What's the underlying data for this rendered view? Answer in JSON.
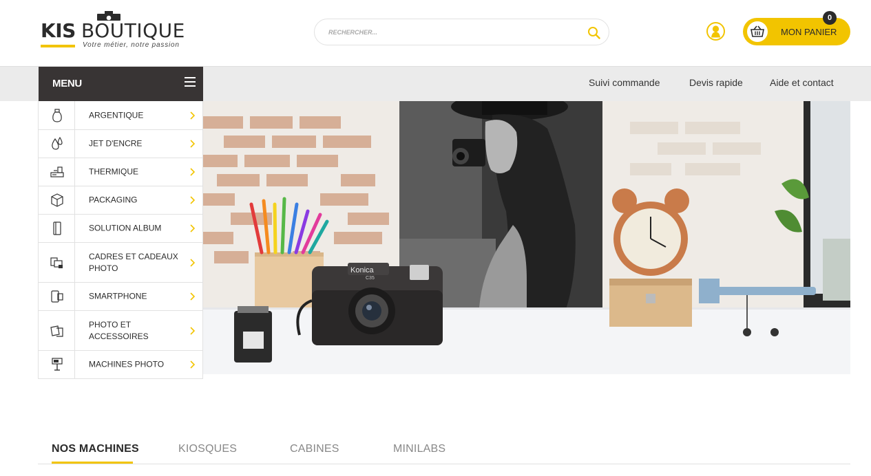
{
  "header": {
    "logo": {
      "brand_bold": "KIS",
      "brand_light": "BOUTIQUE",
      "tagline": "Votre métier, notre passion"
    },
    "search": {
      "placeholder": "RECHERCHER..."
    },
    "cart": {
      "label": "MON PANIER",
      "count": "0"
    },
    "icons": {
      "search": "search-icon",
      "account": "user-account-icon",
      "cart": "basket-icon"
    },
    "colors": {
      "accent": "#f2c400",
      "dark": "#383434"
    }
  },
  "nav": {
    "menu_label": "MENU",
    "links": [
      {
        "label": "Suivi commande"
      },
      {
        "label": "Devis rapide"
      },
      {
        "label": "Aide et contact"
      }
    ]
  },
  "sidebar": {
    "items": [
      {
        "label": "ARGENTIQUE",
        "icon": "film-bottle-icon"
      },
      {
        "label": "JET D'ENCRE",
        "icon": "ink-drops-icon"
      },
      {
        "label": "THERMIQUE",
        "icon": "thermal-printer-icon"
      },
      {
        "label": "PACKAGING",
        "icon": "box-icon"
      },
      {
        "label": "SOLUTION ALBUM",
        "icon": "album-icon"
      },
      {
        "label": "CADRES ET CADEAUX PHOTO",
        "icon": "photo-frames-icon"
      },
      {
        "label": "SMARTPHONE",
        "icon": "smartphone-icon"
      },
      {
        "label": "PHOTO ET ACCESSOIRES",
        "icon": "photo-accessories-icon"
      },
      {
        "label": "MACHINES PHOTO",
        "icon": "photo-kiosk-icon"
      }
    ]
  },
  "hero": {
    "camera_brand": "Konica",
    "camera_model": "C35"
  },
  "tabs": [
    {
      "label": "NOS MACHINES",
      "active": true
    },
    {
      "label": "KIOSQUES",
      "active": false
    },
    {
      "label": "CABINES",
      "active": false
    },
    {
      "label": "MINILABS",
      "active": false
    }
  ]
}
